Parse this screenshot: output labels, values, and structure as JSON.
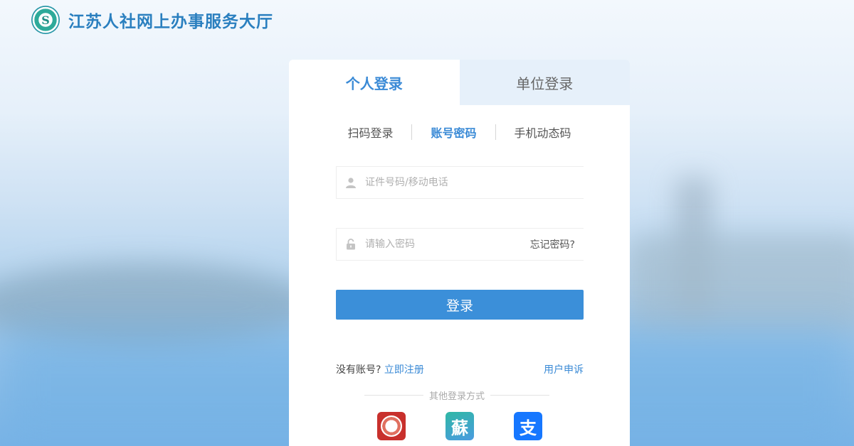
{
  "header": {
    "title": "江苏人社网上办事服务大厅",
    "logo_icon": "jiangsu-hrss-logo"
  },
  "tabs": [
    {
      "label": "个人登录",
      "active": true
    },
    {
      "label": "单位登录",
      "active": false
    }
  ],
  "login_methods": [
    {
      "label": "扫码登录",
      "active": false
    },
    {
      "label": "账号密码",
      "active": true
    },
    {
      "label": "手机动态码",
      "active": false
    }
  ],
  "form": {
    "username_placeholder": "证件号码/移动电话",
    "password_placeholder": "请输入密码",
    "forgot_password": "忘记密码?",
    "submit": "登录"
  },
  "footer": {
    "no_account": "没有账号?",
    "register": "立即注册",
    "appeal": "用户申诉",
    "other_methods": "其他登录方式"
  },
  "third_party": [
    {
      "icon": "jiangsu-hrss-app-icon"
    },
    {
      "icon": "su-service-app-icon",
      "glyph": "蘇"
    },
    {
      "icon": "alipay-icon",
      "glyph": "支"
    }
  ],
  "colors": {
    "accent": "#3b8fd9",
    "title": "#2a7fbf",
    "inactive_tab": "#e6f0fa"
  }
}
